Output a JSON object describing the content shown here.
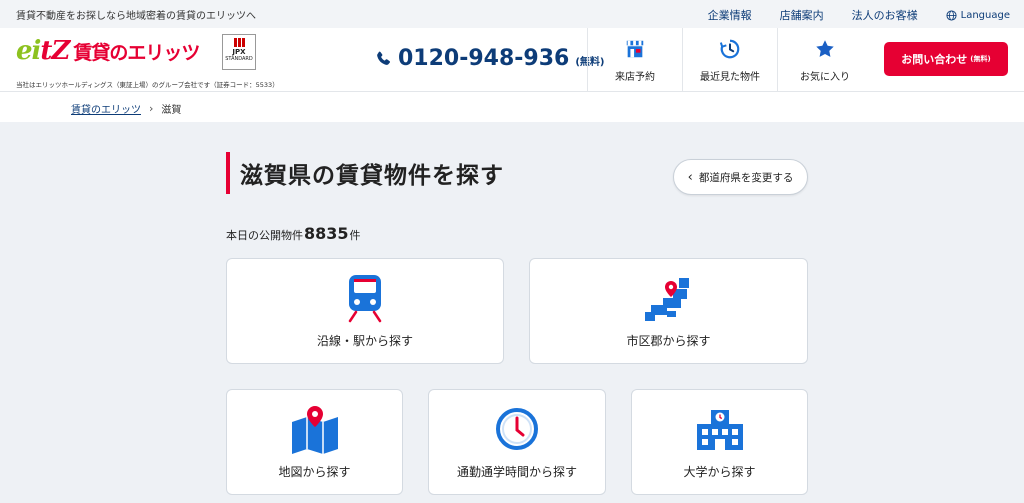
{
  "topbar": {
    "tagline": "賃貸不動産をお探しなら地域密着の賃貸のエリッツへ",
    "links": [
      "企業情報",
      "店舗案内",
      "法人のお客様"
    ],
    "language": "Language"
  },
  "header": {
    "logo_mark": "eitz",
    "logo_text": "賃貸のエリッツ",
    "jpx_line1": "JPX",
    "jpx_line2": "STANDARD",
    "subtag": "当社はエリッツホールディングス（東証上場）のグループ会社です（証券コード：5533）",
    "phone": "0120-948-936",
    "phone_note": "(無料)",
    "nav": [
      "来店予約",
      "最近見た物件",
      "お気に入り"
    ],
    "contact_label": "お問い合わせ",
    "contact_note": "(無料)",
    "accent": "#e60033",
    "navy": "#0d3c78"
  },
  "breadcrumb": {
    "home": "賃貸のエリッツ",
    "current": "滋賀"
  },
  "main": {
    "title": "滋賀県の賃貸物件を探す",
    "change_pref": "都道府県を変更する",
    "count_prefix": "本日の公開物件",
    "count": "8835",
    "count_suffix": "件",
    "cards": [
      {
        "label": "沿線・駅から探す",
        "icon": "train-icon"
      },
      {
        "label": "市区郡から探す",
        "icon": "japan-map-pin-icon"
      },
      {
        "label": "地図から探す",
        "icon": "map-pin-icon"
      },
      {
        "label": "通勤通学時間から探す",
        "icon": "clock-icon"
      },
      {
        "label": "大学から探す",
        "icon": "university-icon"
      }
    ]
  }
}
